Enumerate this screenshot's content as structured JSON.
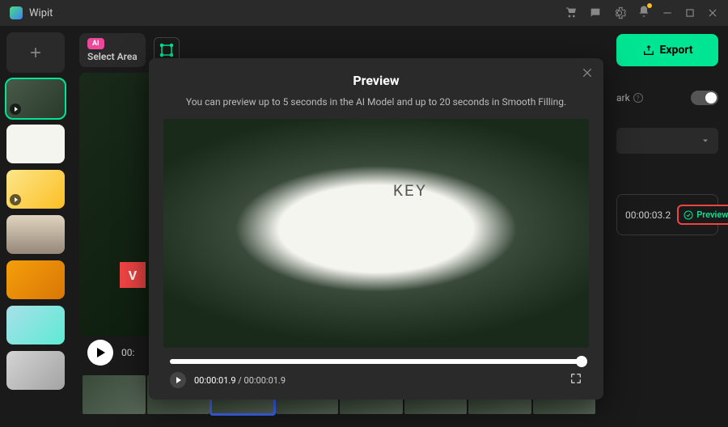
{
  "app": {
    "title": "Wipit"
  },
  "titlebar": {
    "icons": [
      "cart",
      "message",
      "settings",
      "notification",
      "minimize",
      "maximize",
      "close"
    ]
  },
  "toolbar": {
    "ai_badge": "AI",
    "select_area_label": "Select Area"
  },
  "player": {
    "time_display": "00:"
  },
  "rightpanel": {
    "export_label": "Export",
    "mark_label": "ark",
    "segment_time": "00:00:03.2",
    "preview_label": "Preview"
  },
  "modal": {
    "title": "Preview",
    "subtitle": "You can preview up to 5 seconds in the AI Model and up to 20 seconds in Smooth Filling.",
    "notebook_text": "KEY",
    "current_time": "00:00:01.9",
    "total_time": "00:00:01.9",
    "separator": " / "
  },
  "watermark": "V"
}
